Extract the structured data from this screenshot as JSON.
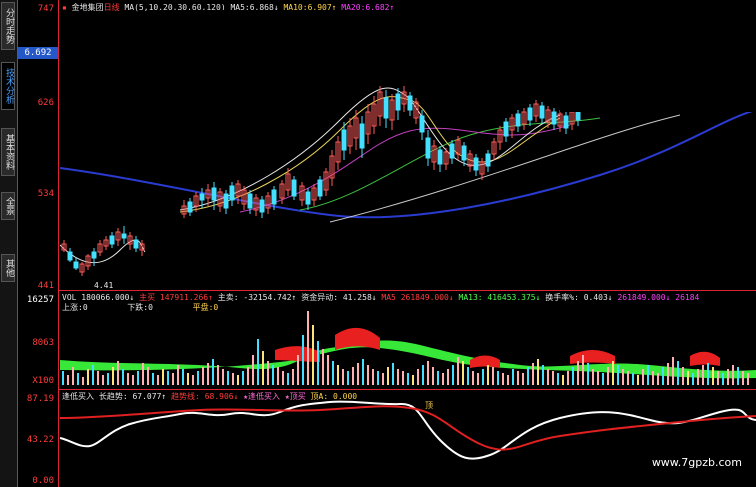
{
  "sidebar": {
    "tabs": [
      {
        "label": "分时走势",
        "active": false
      },
      {
        "label": "技术分析",
        "active": true
      },
      {
        "label": "基本资料",
        "active": false
      },
      {
        "label": "全景",
        "active": false
      },
      {
        "label": "其他",
        "active": false
      }
    ]
  },
  "price_panel": {
    "stock_name": "金地集团",
    "period": "日线",
    "ma_params": "MA(5,10,20,30,60,120)",
    "ma5_label": "MA5:",
    "ma5_value": "6.868↓",
    "ma10_label": "MA10:",
    "ma10_value": "6.907↑",
    "ma20_label": "MA20:",
    "ma20_value": "6.682↑",
    "current_price": "6.692",
    "y_labels": [
      "747",
      "626",
      "534",
      "441"
    ],
    "low_mark": "4.41"
  },
  "volume_panel": {
    "vol_label": "VOL",
    "vol_value": "180066.000↓",
    "main_buy": "主买",
    "main_buy_value": "147911.266↑",
    "main_sell": "主卖",
    "main_sell_value": "-32154.742↑",
    "fund_label": "资金异动",
    "fund_value": "41.258↓",
    "ma5_label": "MA5",
    "ma5_value": "261849.000↓",
    "ma13_label": "MA13:",
    "ma13_value": "416453.375↓",
    "turnover_label": "换手率%",
    "turnover_value": "0.403↓",
    "extra_value": "261849.000↓",
    "extra2_value": "26184",
    "line2_up": "上涨:0",
    "line2_down": "下跌:0",
    "line2_flat": "平盘:0",
    "y_labels": [
      "16257",
      "8063"
    ],
    "x_unit": "X100"
  },
  "indicator_panel": {
    "label1": "逢低买入",
    "label2": "长趋势:",
    "value2": "67.077↑",
    "label3": "趋势线:",
    "value3": "68.906↓",
    "label4": "★逢低买入",
    "label5": "★顶买",
    "label6": "顶A:",
    "value6": "0.000",
    "top_mark": "顶",
    "y_labels": [
      "87.19",
      "43.22",
      "0.00"
    ]
  },
  "watermark": "www.7gpzb.com"
}
